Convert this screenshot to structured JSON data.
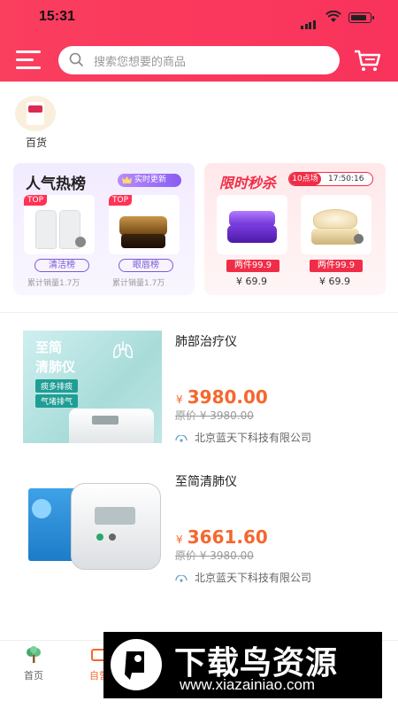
{
  "status": {
    "time": "15:31"
  },
  "search": {
    "placeholder": "搜索您想要的商品"
  },
  "category": {
    "label": "百货"
  },
  "hot_rank": {
    "title": "人气热榜",
    "badge": "实时更新",
    "items": [
      {
        "tag": "TOP",
        "label": "清洁榜",
        "sales": "累计销量1.7万"
      },
      {
        "tag": "TOP",
        "label": "眼唇榜",
        "sales": "累计销量1.7万"
      }
    ]
  },
  "flash_sale": {
    "title": "限时秒杀",
    "session": "10点场",
    "countdown": "17:50:16",
    "items": [
      {
        "promo": "两件99.9",
        "price": "¥ 69.9"
      },
      {
        "promo": "两件99.9",
        "price": "¥ 69.9"
      }
    ]
  },
  "products": [
    {
      "title": "肺部治疗仪",
      "currency": "¥",
      "price": "3980.00",
      "original": "原价 ¥ 3980.00",
      "shop": "北京蓝天下科技有限公司",
      "image_text": {
        "line1": "至简",
        "line2": "清肺仪",
        "tag1": "痰多排痰",
        "tag2": "气堵排气"
      }
    },
    {
      "title": "至简清肺仪",
      "currency": "¥",
      "price": "3661.60",
      "original": "原价 ¥ 3980.00",
      "shop": "北京蓝天下科技有限公司"
    }
  ],
  "tabbar": {
    "tabs": [
      {
        "label": "首页"
      },
      {
        "label": "自营"
      }
    ]
  },
  "watermark": {
    "line1": "下载鸟资源",
    "line2": "www.xiazainiao.com"
  },
  "colors": {
    "brand": "#f9335c",
    "price": "#f4682e",
    "purple": "#7b5bd1"
  }
}
